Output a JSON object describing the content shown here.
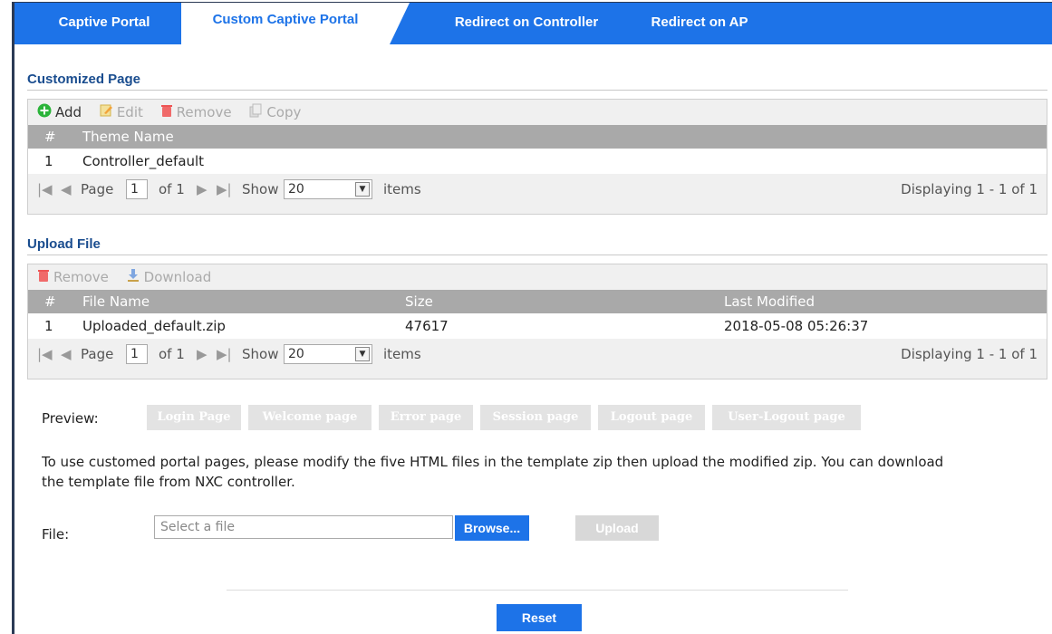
{
  "tabs": [
    {
      "label": "Captive Portal"
    },
    {
      "label": "Custom Captive Portal"
    },
    {
      "label": "Redirect on Controller"
    },
    {
      "label": "Redirect on AP"
    }
  ],
  "customized_page": {
    "title": "Customized Page",
    "toolbar": {
      "add": "Add",
      "edit": "Edit",
      "remove": "Remove",
      "copy": "Copy"
    },
    "columns": [
      "#",
      "Theme Name"
    ],
    "rows": [
      {
        "index": "1",
        "theme_name": "Controller_default"
      }
    ],
    "pager": {
      "page_label": "Page",
      "page_value": "1",
      "of": "of 1",
      "show": "Show",
      "show_value": "20",
      "items": "items",
      "displaying": "Displaying 1 - 1 of 1"
    }
  },
  "upload_file": {
    "title": "Upload File",
    "toolbar": {
      "remove": "Remove",
      "download": "Download"
    },
    "columns": [
      "#",
      "File Name",
      "Size",
      "Last Modified"
    ],
    "rows": [
      {
        "index": "1",
        "file_name": "Uploaded_default.zip",
        "size": "47617",
        "last_modified": "2018-05-08 05:26:37"
      }
    ],
    "pager": {
      "page_label": "Page",
      "page_value": "1",
      "of": "of 1",
      "show": "Show",
      "show_value": "20",
      "items": "items",
      "displaying": "Displaying 1 - 1 of 1"
    }
  },
  "preview": {
    "label": "Preview:",
    "buttons": [
      "Login Page",
      "Welcome page",
      "Error page",
      "Session page",
      "Logout page",
      "User-Logout page"
    ]
  },
  "instructions": {
    "line1": "To use customed portal pages, please modify the five HTML files in the template zip then upload the modified zip. You can download",
    "line2": "the template file from NXC controller."
  },
  "file_upload": {
    "label": "File:",
    "placeholder": "Select a file",
    "browse": "Browse...",
    "upload": "Upload"
  },
  "reset_label": "Reset",
  "colors": {
    "accent": "#1d73e8",
    "header_gray": "#a9a9a9",
    "section_title": "#1a4d8f"
  }
}
